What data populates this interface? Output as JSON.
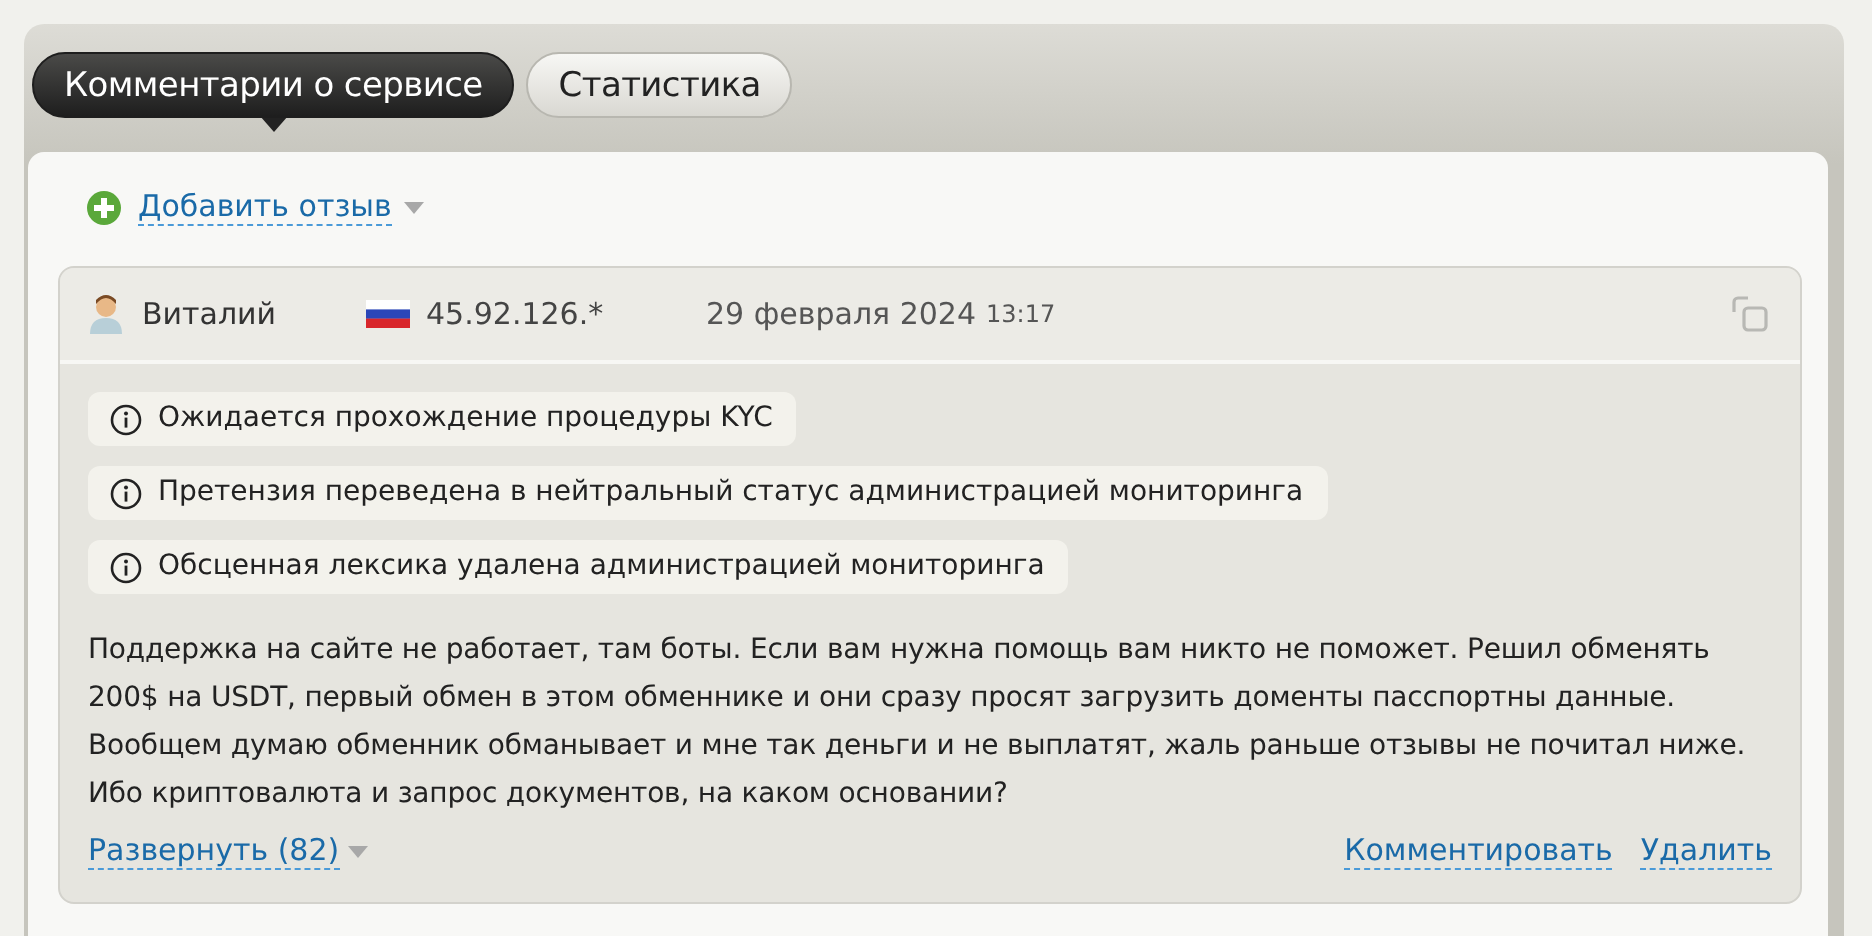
{
  "tabs": [
    {
      "label": "Комментарии о сервисе",
      "selected": true
    },
    {
      "label": "Статистика",
      "selected": false
    }
  ],
  "add_review": {
    "label": "Добавить отзыв"
  },
  "review": {
    "author": "Виталий",
    "ip": "45.92.126.*",
    "date": "29 февраля 2024",
    "time": "13:17",
    "notices": [
      "Ожидается прохождение процедуры KYC",
      "Претензия переведена в нейтральный статус администрацией мониторинга",
      "Обсценная лексика удалена администрацией мониторинга"
    ],
    "text": "Поддержка на сайте не работает, там боты. Если вам нужна помощь вам никто не поможет. Решил обменять 200$ на USDT, первый обмен в этом обменнике и они сразу просят загрузить доменты пасспортны данные. Вообщем думаю обменник обманывает и мне так деньги и не выплатят, жаль раньше отзывы не почитал ниже. Ибо криптовалюта и запрос документов, на каком основании?",
    "expand": "Развернуть (82)",
    "actions": [
      "Комментировать",
      "Удалить"
    ]
  }
}
